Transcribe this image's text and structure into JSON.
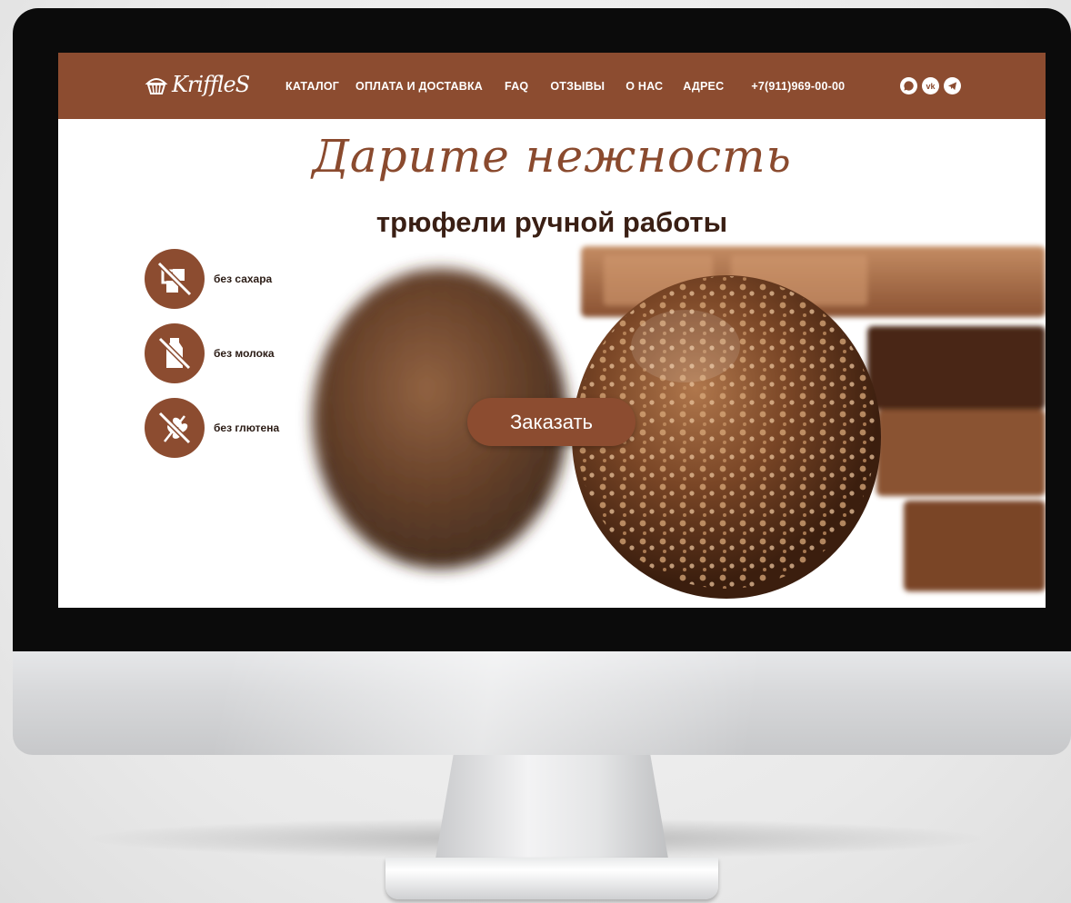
{
  "brand": {
    "logo_text": "KriffleS"
  },
  "nav": {
    "items": [
      {
        "label": "КАТАЛОГ"
      },
      {
        "label": "ОПЛАТА И ДОСТАВКА"
      },
      {
        "label": "FAQ"
      },
      {
        "label": "ОТЗЫВЫ"
      },
      {
        "label": "О НАС"
      },
      {
        "label": "АДРЕС"
      }
    ],
    "phone": "+7(911)969-00-00"
  },
  "socials": [
    {
      "icon": "whatsapp-icon"
    },
    {
      "icon": "vk-icon",
      "label": "vk"
    },
    {
      "icon": "telegram-icon"
    }
  ],
  "hero": {
    "headline": "Дарите нежность",
    "subheadline": "трюфели ручной работы",
    "cta_label": "Заказать",
    "features": [
      {
        "label": "без сахара",
        "icon": "no-sugar-icon"
      },
      {
        "label": "без молока",
        "icon": "no-milk-icon"
      },
      {
        "label": "без глютена",
        "icon": "no-gluten-icon"
      }
    ]
  },
  "colors": {
    "brand": "#8c4c30",
    "text_dark": "#3a1f14",
    "headline": "#8a4a2e"
  }
}
